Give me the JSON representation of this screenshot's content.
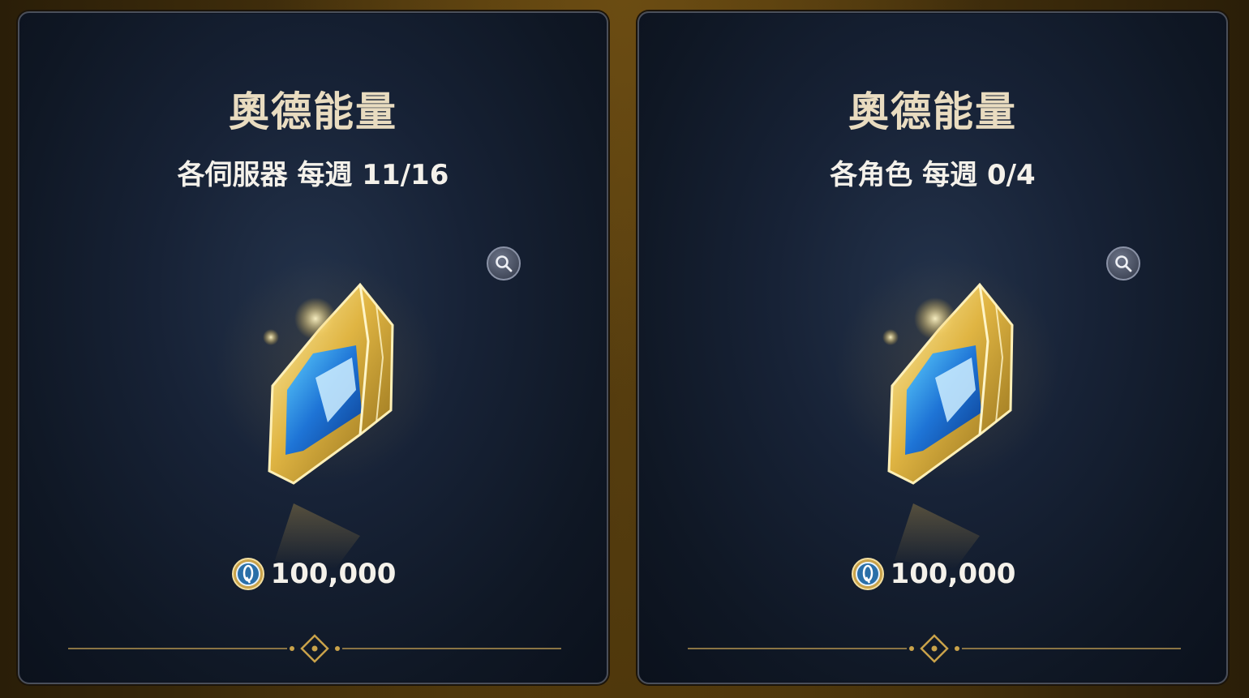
{
  "colors": {
    "title": "#e9dcc0",
    "text": "#f4f1ea",
    "gold": "#c9a24a",
    "card_bg": "#172236"
  },
  "cards": [
    {
      "title": "奧德能量",
      "limit": "各伺服器 每週 11/16",
      "price": "100,000",
      "item_icon": "energy-crystal-icon",
      "currency_icon": "currency-coin-icon"
    },
    {
      "title": "奧德能量",
      "limit": "各角色 每週 0/4",
      "price": "100,000",
      "item_icon": "energy-crystal-icon",
      "currency_icon": "currency-coin-icon"
    }
  ]
}
